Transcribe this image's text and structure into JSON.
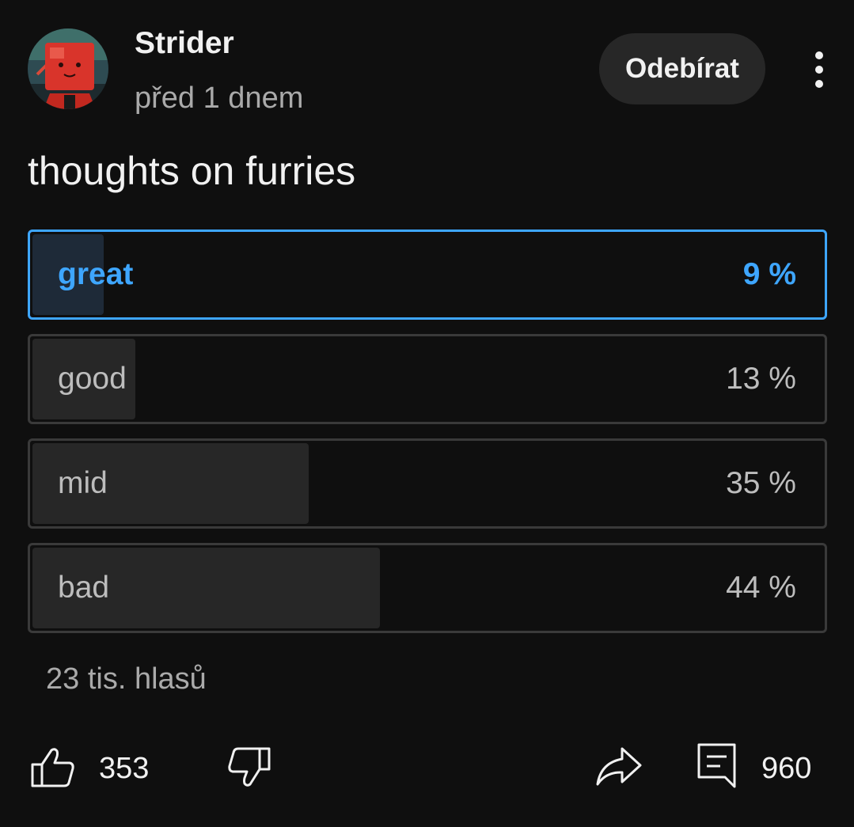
{
  "post": {
    "channel_name": "Strider",
    "timestamp": "před 1 dnem",
    "subscribe_label": "Odebírat",
    "text": "thoughts on furries"
  },
  "poll": {
    "options": [
      {
        "label": "great",
        "percent_label": "9 %",
        "percent": 9,
        "selected": true
      },
      {
        "label": "good",
        "percent_label": "13 %",
        "percent": 13,
        "selected": false
      },
      {
        "label": "mid",
        "percent_label": "35 %",
        "percent": 35,
        "selected": false
      },
      {
        "label": "bad",
        "percent_label": "44 %",
        "percent": 44,
        "selected": false
      }
    ],
    "vote_count": "23 tis. hlasů"
  },
  "actions": {
    "likes": "353",
    "comments": "960"
  },
  "icons": {
    "like": "thumbs-up-icon",
    "dislike": "thumbs-down-icon",
    "share": "share-icon",
    "comment": "comment-icon",
    "more": "more-vert-icon"
  },
  "colors": {
    "background": "#0f0f0f",
    "accent": "#3ea6ff",
    "muted_text": "#aaaaaa"
  }
}
